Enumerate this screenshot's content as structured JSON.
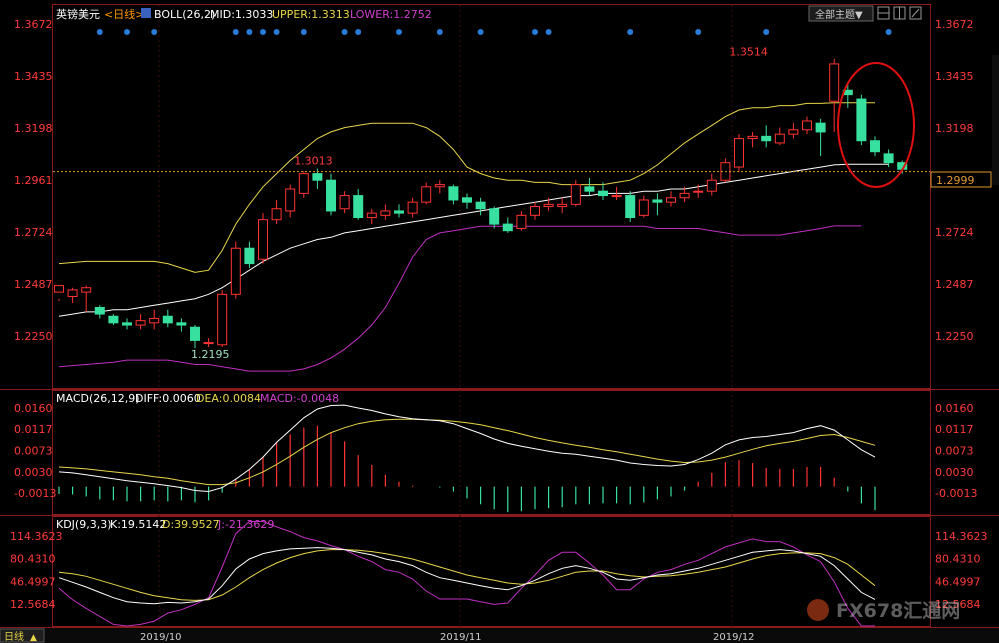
{
  "header": {
    "instrument": "英镑美元",
    "period": "<日线>",
    "boll_label": "BOLL(26,2)",
    "mid_label": "MID:1.3033",
    "upper_label": "UPPER:1.3313",
    "lower_label": "LOWER:1.2752",
    "theme_button": "全部主题▼"
  },
  "macd_header": {
    "name": "MACD(26,12,9)",
    "diff": "DIFF:0.0060",
    "dea": "DEA:0.0084",
    "macd": "MACD:-0.0048"
  },
  "kdj_header": {
    "name": "KDJ(9,3,3)",
    "k": "K:19.5142",
    "d": "D:39.9527",
    "j": "J:-21.3629"
  },
  "footer": {
    "period_tab": "日线",
    "months": [
      "2019/10",
      "2019/11",
      "2019/12"
    ]
  },
  "watermark": "FX678汇通网",
  "colors": {
    "up": "#ff3333",
    "down": "#38e0a0",
    "mid": "#ffffff",
    "upper": "#e8d64a",
    "lower": "#c030c0",
    "axis_text": "#ff3b3b",
    "dot": "#2a7ad8",
    "circle": "#e01010"
  },
  "chart_data": {
    "type": "candlestick",
    "price_axis": {
      "ticks": [
        "1.3672",
        "1.3435",
        "1.3198",
        "1.2961",
        "1.2724",
        "1.2487",
        "1.2250"
      ],
      "ylim": [
        1.205,
        1.3672
      ],
      "current_price": "1.2999",
      "current_value": 1.2999
    },
    "annotations": {
      "high": {
        "text": "1.3514",
        "value": 1.3514,
        "index": 49
      },
      "prev_high": {
        "text": "1.3013",
        "value": 1.3013,
        "index": 17
      },
      "low": {
        "text": "1.2195",
        "value": 1.2195,
        "index": 10
      }
    },
    "candles": [
      [
        1.245,
        1.248,
        1.242,
        1.241
      ],
      [
        1.243,
        1.246,
        1.247,
        1.24
      ],
      [
        1.245,
        1.247,
        1.248,
        1.236
      ],
      [
        1.238,
        1.235,
        1.239,
        1.233
      ],
      [
        1.234,
        1.231,
        1.235,
        1.23
      ],
      [
        1.231,
        1.23,
        1.233,
        1.228
      ],
      [
        1.23,
        1.232,
        1.235,
        1.228
      ],
      [
        1.231,
        1.233,
        1.237,
        1.228
      ],
      [
        1.234,
        1.231,
        1.237,
        1.229
      ],
      [
        1.231,
        1.23,
        1.233,
        1.227
      ],
      [
        1.229,
        1.223,
        1.23,
        1.2195
      ],
      [
        1.222,
        1.222,
        1.224,
        1.22
      ],
      [
        1.221,
        1.244,
        1.246,
        1.22
      ],
      [
        1.244,
        1.265,
        1.268,
        1.242
      ],
      [
        1.265,
        1.258,
        1.268,
        1.256
      ],
      [
        1.26,
        1.278,
        1.281,
        1.258
      ],
      [
        1.278,
        1.283,
        1.287,
        1.276
      ],
      [
        1.282,
        1.292,
        1.294,
        1.279
      ],
      [
        1.29,
        1.299,
        1.3,
        1.288
      ],
      [
        1.299,
        1.296,
        1.3013,
        1.292
      ],
      [
        1.296,
        1.282,
        1.299,
        1.28
      ],
      [
        1.283,
        1.289,
        1.291,
        1.281
      ],
      [
        1.289,
        1.279,
        1.292,
        1.278
      ],
      [
        1.279,
        1.281,
        1.283,
        1.276
      ],
      [
        1.28,
        1.282,
        1.285,
        1.278
      ],
      [
        1.282,
        1.281,
        1.285,
        1.279
      ],
      [
        1.281,
        1.286,
        1.288,
        1.279
      ],
      [
        1.286,
        1.293,
        1.295,
        1.285
      ],
      [
        1.293,
        1.294,
        1.296,
        1.29
      ],
      [
        1.293,
        1.287,
        1.294,
        1.285
      ],
      [
        1.288,
        1.286,
        1.29,
        1.283
      ],
      [
        1.286,
        1.283,
        1.288,
        1.28
      ],
      [
        1.283,
        1.276,
        1.284,
        1.274
      ],
      [
        1.276,
        1.273,
        1.279,
        1.272
      ],
      [
        1.274,
        1.28,
        1.282,
        1.273
      ],
      [
        1.28,
        1.284,
        1.286,
        1.278
      ],
      [
        1.284,
        1.285,
        1.288,
        1.282
      ],
      [
        1.284,
        1.285,
        1.288,
        1.281
      ],
      [
        1.285,
        1.294,
        1.296,
        1.284
      ],
      [
        1.293,
        1.291,
        1.297,
        1.289
      ],
      [
        1.291,
        1.289,
        1.295,
        1.287
      ],
      [
        1.289,
        1.289,
        1.293,
        1.287
      ],
      [
        1.289,
        1.279,
        1.291,
        1.277
      ],
      [
        1.28,
        1.287,
        1.289,
        1.279
      ],
      [
        1.287,
        1.286,
        1.29,
        1.28
      ],
      [
        1.286,
        1.288,
        1.291,
        1.284
      ],
      [
        1.288,
        1.29,
        1.293,
        1.286
      ],
      [
        1.291,
        1.291,
        1.294,
        1.288
      ],
      [
        1.291,
        1.296,
        1.299,
        1.289
      ],
      [
        1.296,
        1.304,
        1.306,
        1.295
      ],
      [
        1.302,
        1.315,
        1.317,
        1.3
      ],
      [
        1.315,
        1.316,
        1.318,
        1.311
      ],
      [
        1.316,
        1.314,
        1.321,
        1.311
      ],
      [
        1.313,
        1.317,
        1.32,
        1.312
      ],
      [
        1.317,
        1.319,
        1.322,
        1.315
      ],
      [
        1.319,
        1.323,
        1.325,
        1.317
      ],
      [
        1.322,
        1.318,
        1.324,
        1.307
      ],
      [
        1.332,
        1.349,
        1.3514,
        1.318
      ],
      [
        1.337,
        1.335,
        1.34,
        1.329
      ],
      [
        1.333,
        1.314,
        1.335,
        1.312
      ],
      [
        1.314,
        1.309,
        1.316,
        1.307
      ],
      [
        1.308,
        1.304,
        1.31,
        1.302
      ],
      [
        1.304,
        1.301,
        1.305,
        1.299
      ]
    ],
    "boll_mid": [
      1.234,
      1.235,
      1.236,
      1.236,
      1.237,
      1.237,
      1.238,
      1.239,
      1.24,
      1.241,
      1.242,
      1.244,
      1.247,
      1.251,
      1.255,
      1.259,
      1.262,
      1.265,
      1.267,
      1.269,
      1.27,
      1.272,
      1.273,
      1.274,
      1.275,
      1.276,
      1.277,
      1.278,
      1.279,
      1.28,
      1.281,
      1.282,
      1.283,
      1.284,
      1.285,
      1.286,
      1.287,
      1.288,
      1.289,
      1.289,
      1.29,
      1.29,
      1.29,
      1.291,
      1.291,
      1.292,
      1.292,
      1.293,
      1.294,
      1.295,
      1.296,
      1.297,
      1.298,
      1.299,
      1.3,
      1.301,
      1.302,
      1.303,
      1.3033,
      1.3033,
      1.3033,
      1.3033
    ],
    "boll_upper": [
      1.258,
      1.2585,
      1.259,
      1.259,
      1.259,
      1.259,
      1.259,
      1.259,
      1.258,
      1.256,
      1.254,
      1.255,
      1.264,
      1.276,
      1.285,
      1.293,
      1.299,
      1.305,
      1.31,
      1.315,
      1.318,
      1.32,
      1.321,
      1.322,
      1.322,
      1.322,
      1.322,
      1.32,
      1.316,
      1.31,
      1.302,
      1.299,
      1.297,
      1.296,
      1.296,
      1.295,
      1.295,
      1.294,
      1.294,
      1.294,
      1.294,
      1.295,
      1.296,
      1.299,
      1.303,
      1.308,
      1.313,
      1.317,
      1.321,
      1.325,
      1.328,
      1.329,
      1.329,
      1.33,
      1.33,
      1.331,
      1.331,
      1.3313,
      1.3313,
      1.3313,
      1.3313
    ],
    "boll_lower": [
      1.211,
      1.2115,
      1.212,
      1.2125,
      1.213,
      1.214,
      1.214,
      1.214,
      1.214,
      1.213,
      1.212,
      1.212,
      1.211,
      1.21,
      1.209,
      1.209,
      1.209,
      1.209,
      1.21,
      1.212,
      1.215,
      1.219,
      1.224,
      1.23,
      1.238,
      1.249,
      1.261,
      1.269,
      1.272,
      1.273,
      1.274,
      1.275,
      1.275,
      1.275,
      1.275,
      1.275,
      1.275,
      1.275,
      1.275,
      1.275,
      1.275,
      1.275,
      1.275,
      1.275,
      1.274,
      1.274,
      1.274,
      1.274,
      1.273,
      1.272,
      1.271,
      1.271,
      1.271,
      1.271,
      1.272,
      1.273,
      1.274,
      1.2752,
      1.2752,
      1.2752
    ],
    "event_dots": [
      3,
      5,
      7,
      13,
      14,
      15,
      16,
      18,
      21,
      22,
      25,
      28,
      31,
      35,
      36,
      42,
      47,
      52,
      61
    ],
    "macd_axis": {
      "ticks": [
        "0.0160",
        "0.0117",
        "0.0073",
        "0.0030",
        "-0.0013"
      ],
      "ylim": [
        -0.004,
        0.0175
      ]
    },
    "macd_diff": [
      0.003,
      0.0028,
      0.0024,
      0.002,
      0.0016,
      0.0012,
      0.0009,
      0.0006,
      0.0002,
      -0.0002,
      -0.0008,
      -0.001,
      -0.0002,
      0.0015,
      0.0035,
      0.006,
      0.009,
      0.0115,
      0.014,
      0.0158,
      0.0165,
      0.0166,
      0.016,
      0.0155,
      0.0148,
      0.0142,
      0.0138,
      0.0136,
      0.0134,
      0.0128,
      0.0118,
      0.0108,
      0.0097,
      0.0088,
      0.0082,
      0.0077,
      0.0072,
      0.0068,
      0.0066,
      0.0062,
      0.0058,
      0.0054,
      0.0048,
      0.0045,
      0.0043,
      0.0042,
      0.0045,
      0.0055,
      0.0068,
      0.0085,
      0.0095,
      0.01,
      0.0102,
      0.0106,
      0.011,
      0.0118,
      0.0124,
      0.0115,
      0.0095,
      0.0075,
      0.006
    ],
    "macd_dea": [
      0.004,
      0.0038,
      0.0036,
      0.0033,
      0.003,
      0.0027,
      0.0024,
      0.002,
      0.0017,
      0.0012,
      0.0008,
      0.0004,
      0.0004,
      0.0008,
      0.0018,
      0.003,
      0.0045,
      0.0062,
      0.008,
      0.0096,
      0.011,
      0.012,
      0.0128,
      0.0133,
      0.0136,
      0.0137,
      0.0137,
      0.0136,
      0.0135,
      0.0133,
      0.013,
      0.0126,
      0.012,
      0.0114,
      0.0107,
      0.01,
      0.0094,
      0.0089,
      0.0084,
      0.008,
      0.0075,
      0.0071,
      0.0066,
      0.0061,
      0.0056,
      0.0052,
      0.0049,
      0.005,
      0.0054,
      0.006,
      0.0068,
      0.0076,
      0.0083,
      0.0088,
      0.0092,
      0.0098,
      0.0104,
      0.0106,
      0.01,
      0.0092,
      0.0084
    ],
    "macd_hist": [
      -0.0015,
      -0.0016,
      -0.002,
      -0.0026,
      -0.0028,
      -0.003,
      -0.003,
      -0.0028,
      -0.003,
      -0.0028,
      -0.0032,
      -0.0028,
      -0.0012,
      0.0014,
      0.0034,
      0.006,
      0.009,
      0.0106,
      0.012,
      0.0124,
      0.011,
      0.0092,
      0.0064,
      0.0044,
      0.0024,
      0.001,
      0.0002,
      0.0,
      -0.0002,
      -0.001,
      -0.0024,
      -0.0036,
      -0.0046,
      -0.0052,
      -0.005,
      -0.0046,
      -0.0044,
      -0.0042,
      -0.0036,
      -0.0036,
      -0.0034,
      -0.0034,
      -0.0036,
      -0.0032,
      -0.0026,
      -0.002,
      -0.0008,
      0.001,
      0.0028,
      0.005,
      0.0054,
      0.0048,
      0.0038,
      0.0036,
      0.0036,
      0.004,
      0.004,
      0.0018,
      -0.001,
      -0.0034,
      -0.0048
    ],
    "kdj_axis": {
      "ticks": [
        "114.3623",
        "80.4310",
        "46.4997",
        "12.5684"
      ],
      "ylim": [
        -25,
        125
      ]
    },
    "kdj_k": [
      52,
      45,
      38,
      30,
      22,
      16,
      14,
      13,
      15,
      14,
      16,
      20,
      40,
      65,
      80,
      88,
      92,
      95,
      96,
      97,
      96,
      94,
      90,
      86,
      80,
      76,
      70,
      60,
      52,
      48,
      44,
      40,
      36,
      34,
      40,
      48,
      58,
      66,
      70,
      66,
      60,
      50,
      48,
      52,
      56,
      58,
      62,
      66,
      72,
      78,
      84,
      90,
      92,
      94,
      92,
      88,
      84,
      70,
      50,
      30,
      19.5
    ],
    "kdj_d": [
      60,
      58,
      54,
      48,
      42,
      36,
      30,
      25,
      22,
      19,
      18,
      19,
      26,
      38,
      52,
      64,
      74,
      82,
      88,
      92,
      94,
      94,
      93,
      91,
      88,
      84,
      80,
      74,
      68,
      62,
      56,
      52,
      48,
      44,
      42,
      44,
      48,
      54,
      60,
      62,
      62,
      58,
      55,
      53,
      54,
      55,
      57,
      60,
      64,
      68,
      74,
      80,
      85,
      88,
      89,
      89,
      88,
      82,
      72,
      56,
      40
    ],
    "kdj_j": [
      36,
      19,
      6,
      -6,
      -18,
      -24,
      -18,
      -13,
      -1,
      4,
      12,
      22,
      68,
      118,
      136,
      136,
      128,
      121,
      112,
      107,
      100,
      94,
      84,
      76,
      64,
      60,
      50,
      32,
      20,
      20,
      20,
      16,
      12,
      14,
      36,
      56,
      78,
      90,
      90,
      74,
      56,
      34,
      34,
      50,
      60,
      64,
      72,
      78,
      88,
      98,
      104,
      110,
      106,
      106,
      98,
      86,
      76,
      46,
      6,
      -22,
      -21.4
    ]
  }
}
